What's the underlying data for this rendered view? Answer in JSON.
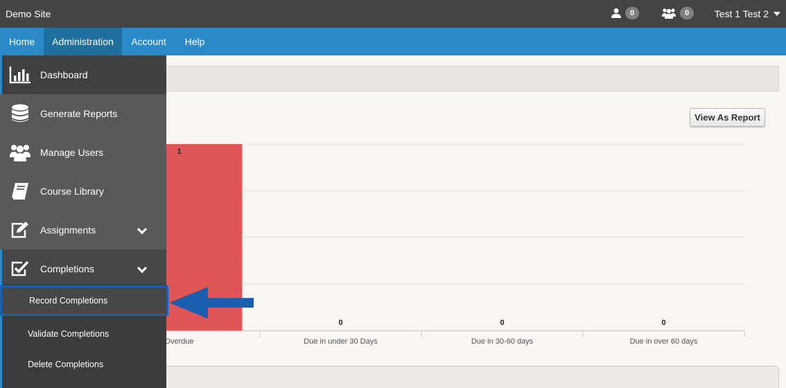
{
  "header": {
    "site_title": "Demo Site",
    "user_count": "0",
    "group_count": "0",
    "user_name": "Test 1 Test 2"
  },
  "nav": {
    "items": [
      {
        "label": "Home"
      },
      {
        "label": "Administration"
      },
      {
        "label": "Account"
      },
      {
        "label": "Help"
      }
    ],
    "active": "Administration"
  },
  "sidebar": {
    "items": [
      {
        "label": "Dashboard",
        "icon": "bar-chart-icon"
      },
      {
        "label": "Generate Reports",
        "icon": "database-icon"
      },
      {
        "label": "Manage Users",
        "icon": "users-icon"
      },
      {
        "label": "Course Library",
        "icon": "book-icon"
      },
      {
        "label": "Assignments",
        "icon": "edit-icon"
      },
      {
        "label": "Completions",
        "icon": "checkbox-icon"
      }
    ],
    "sub_items": [
      {
        "label": "Record Completions"
      },
      {
        "label": "Validate Completions"
      },
      {
        "label": "Delete Completions"
      }
    ]
  },
  "main": {
    "view_report_label": "View As Report"
  },
  "chart_data": {
    "type": "bar",
    "categories": [
      "Overdue",
      "Due in under 30 Days",
      "Due in 30-60 days",
      "Due in over 60 days"
    ],
    "values": [
      1,
      0,
      0,
      0
    ],
    "ylim": [
      0,
      1
    ],
    "grid": true,
    "colors": [
      "#e05555"
    ]
  },
  "colors": {
    "topbar": "#444444",
    "navbar": "#2a8ac7",
    "sidebar": "#595959",
    "bar": "#e05555",
    "arrow": "#1b5fb0"
  }
}
